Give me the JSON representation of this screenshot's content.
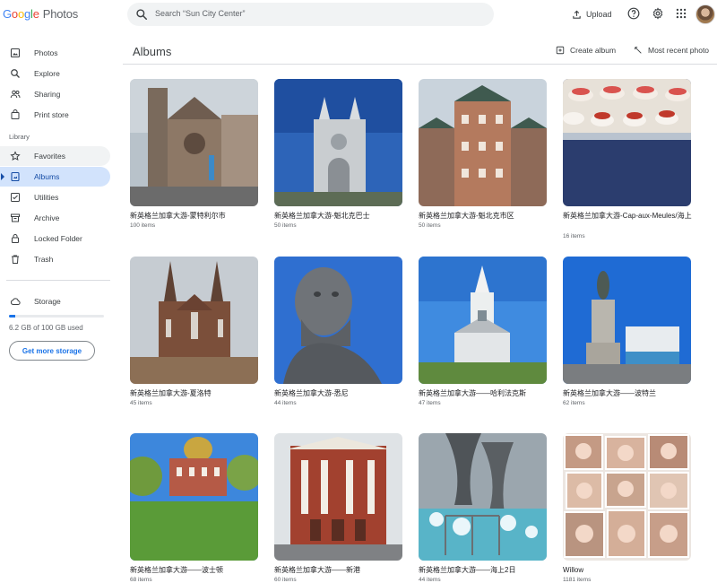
{
  "app": {
    "logo_word": "Google",
    "product": "Photos"
  },
  "search": {
    "placeholder": "Search “Sun City Center”"
  },
  "header": {
    "upload_label": "Upload",
    "icons": [
      "help-icon",
      "settings-icon",
      "apps-grid-icon"
    ]
  },
  "sidebar": {
    "items": [
      {
        "label": "Photos",
        "icon": "photos-icon"
      },
      {
        "label": "Explore",
        "icon": "explore-icon"
      },
      {
        "label": "Sharing",
        "icon": "sharing-icon"
      },
      {
        "label": "Print store",
        "icon": "print-store-icon"
      }
    ],
    "library_label": "Library",
    "library_items": [
      {
        "label": "Favorites",
        "icon": "star-icon"
      },
      {
        "label": "Albums",
        "icon": "albums-icon",
        "selected": true
      },
      {
        "label": "Utilities",
        "icon": "utilities-icon"
      },
      {
        "label": "Archive",
        "icon": "archive-icon"
      },
      {
        "label": "Locked Folder",
        "icon": "lock-icon"
      },
      {
        "label": "Trash",
        "icon": "trash-icon"
      }
    ],
    "storage_label": "Storage",
    "storage_used": "6.2 GB of 100 GB used",
    "storage_fraction": 0.062,
    "get_more_storage": "Get more storage"
  },
  "main": {
    "title": "Albums",
    "create_album": "Create album",
    "sort_label": "Most recent photo",
    "albums": [
      {
        "title": "新英格兰加拿大游-蒙特利尔市",
        "count": "100 items"
      },
      {
        "title": "新英格兰加拿大游-魁北克巴士",
        "count": "50 items"
      },
      {
        "title": "新英格兰加拿大游-魁北克市区",
        "count": "50 items"
      },
      {
        "title": "新英格兰加拿大游-Cap-aux-Meules/海上",
        "count": "16 items"
      },
      {
        "title": "新英格兰加拿大游-夏洛特",
        "count": "45 items"
      },
      {
        "title": "新英格兰加拿大游-悉尼",
        "count": "44 items"
      },
      {
        "title": "新英格兰加拿大游——哈利法克斯",
        "count": "47 items"
      },
      {
        "title": "新英格兰加拿大游——波特兰",
        "count": "62 items"
      },
      {
        "title": "新英格兰加拿大游——波士顿",
        "count": "68 items"
      },
      {
        "title": "新英格兰加拿大游——新港",
        "count": "60 items"
      },
      {
        "title": "新英格兰加拿大游——海上2日",
        "count": "44 items"
      },
      {
        "title": "Willow",
        "count": "1181 items"
      }
    ]
  },
  "colors": {
    "accent": "#1a73e8",
    "selected_bg": "#d2e3fc",
    "divider": "#dadce0"
  }
}
